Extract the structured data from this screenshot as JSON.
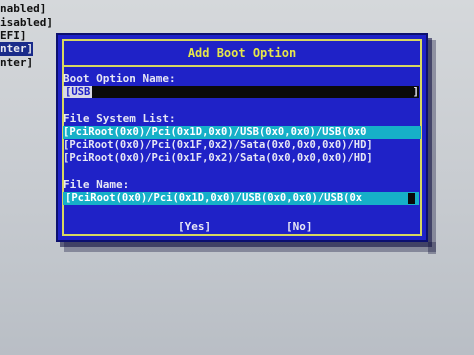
{
  "background_lines": [
    {
      "text": "nabled]",
      "selected": false
    },
    {
      "text": "isabled]",
      "selected": false
    },
    {
      "text": "EFI]",
      "selected": false
    },
    {
      "text": "nter]",
      "selected": true
    },
    {
      "text": "nter]",
      "selected": false
    }
  ],
  "dialog": {
    "title": "Add Boot Option",
    "boot_option_name_label": "Boot Option Name:",
    "boot_option_name_value": "[USB",
    "boot_option_name_end": "]",
    "file_system_list_label": "File System List:",
    "file_systems": [
      {
        "text": "[PciRoot(0x0)/Pci(0x1D,0x0)/USB(0x0,0x0)/USB(0x0",
        "selected": true
      },
      {
        "text": "[PciRoot(0x0)/Pci(0x1F,0x2)/Sata(0x0,0x0,0x0)/HD]",
        "selected": false
      },
      {
        "text": "[PciRoot(0x0)/Pci(0x1F,0x2)/Sata(0x0,0x0,0x0)/HD]",
        "selected": false
      }
    ],
    "file_name_label": "File Name:",
    "file_name_value": "[PciRoot(0x0)/Pci(0x1D,0x0)/USB(0x0,0x0)/USB(0x",
    "yes_button": "[Yes]",
    "no_button": "[No]"
  },
  "colors": {
    "dialog_bg": "#1f22c7",
    "border": "#d8d860",
    "title": "#e6e64a",
    "highlight": "#16b0c8",
    "text": "#e6e6f5"
  }
}
